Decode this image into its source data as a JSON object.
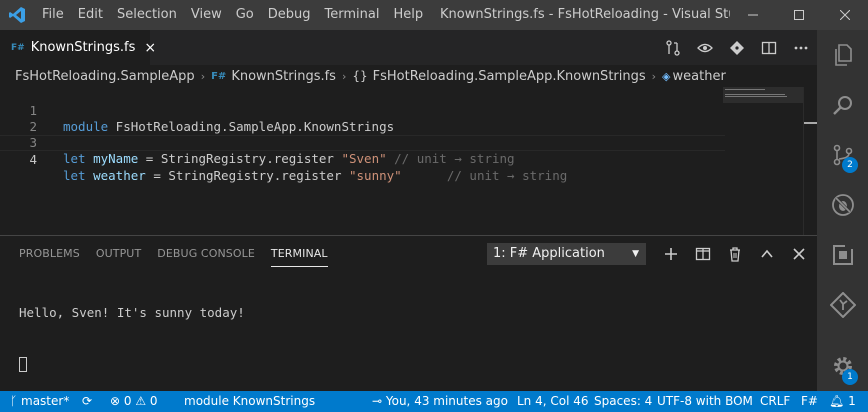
{
  "titlebar": {
    "menu": [
      "File",
      "Edit",
      "Selection",
      "View",
      "Go",
      "Debug",
      "Terminal",
      "Help"
    ],
    "title": "KnownStrings.fs - FsHotReloading - Visual Studio Co..."
  },
  "tabs": [
    {
      "badge": "F#",
      "label": "KnownStrings.fs",
      "close": "×"
    }
  ],
  "breadcrumb": {
    "project": "FsHotReloading.SampleApp",
    "file_badge": "F#",
    "file": "KnownStrings.fs",
    "module_icon": "{}",
    "module": "FsHotReloading.SampleApp.KnownStrings",
    "symbol": "weather"
  },
  "editor": {
    "lines": [
      {
        "num": "1",
        "kw": "module",
        "rest": " FsHotReloading.SampleApp.KnownStrings"
      },
      {
        "num": "2"
      },
      {
        "num": "3",
        "kw": "let",
        "id": " myName",
        "mid": " = StringRegistry.register ",
        "str": "\"Sven\"",
        "comment": " // unit → string"
      },
      {
        "num": "4",
        "kw": "let",
        "id": " weather",
        "mid": " = StringRegistry.register ",
        "str": "\"sunny\"",
        "comment": "      // unit → string"
      }
    ]
  },
  "panel": {
    "tabs": [
      "PROBLEMS",
      "OUTPUT",
      "DEBUG CONSOLE",
      "TERMINAL"
    ],
    "active_tab": "TERMINAL",
    "terminal_select": "1: F# Application",
    "terminal_output": "Hello, Sven! It's sunny today!"
  },
  "activity": {
    "scm_badge": "2",
    "settings_badge": "1"
  },
  "statusbar": {
    "branch": "master*",
    "errors": "0",
    "warnings": "0",
    "module": "module KnownStrings",
    "blame": "You, 43 minutes ago",
    "position": "Ln 4, Col 46",
    "spaces": "Spaces: 4",
    "encoding": "UTF-8 with BOM",
    "eol": "CRLF",
    "language": "F#",
    "notifications": "1"
  },
  "colors": {
    "accent": "#007acc",
    "keyword": "#569cd6",
    "string": "#ce9178",
    "comment": "#6a6a6a",
    "fsharp": "#378bba"
  }
}
